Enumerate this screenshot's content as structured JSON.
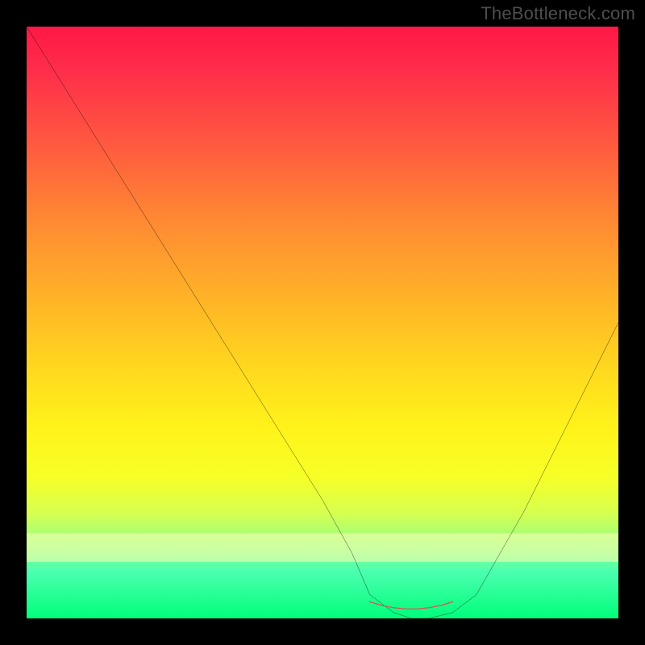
{
  "watermark": "TheBottleneck.com",
  "chart_data": {
    "type": "line",
    "title": "",
    "xlabel": "",
    "ylabel": "",
    "xlim": [
      0,
      100
    ],
    "ylim": [
      0,
      100
    ],
    "grid": false,
    "series": [
      {
        "name": "bottleneck-curve",
        "x": [
          0,
          5,
          10,
          15,
          20,
          25,
          30,
          35,
          40,
          45,
          50,
          55,
          58,
          62,
          65,
          68,
          72,
          76,
          80,
          84,
          88,
          92,
          96,
          100
        ],
        "values": [
          100,
          92,
          84,
          76,
          68,
          60,
          52,
          44,
          36,
          28,
          20,
          11,
          4,
          1,
          0,
          0,
          1,
          4,
          11,
          18,
          26,
          34,
          42,
          50
        ]
      },
      {
        "name": "optimal-range-marker",
        "x": [
          58,
          60,
          62,
          64,
          66,
          68,
          70,
          72
        ],
        "values": [
          2.8,
          2.2,
          1.8,
          1.6,
          1.6,
          1.8,
          2.2,
          2.8
        ]
      }
    ],
    "background_gradient": {
      "top": "#ff1846",
      "mid": "#fff31a",
      "bottom": "#00ff7a"
    }
  }
}
